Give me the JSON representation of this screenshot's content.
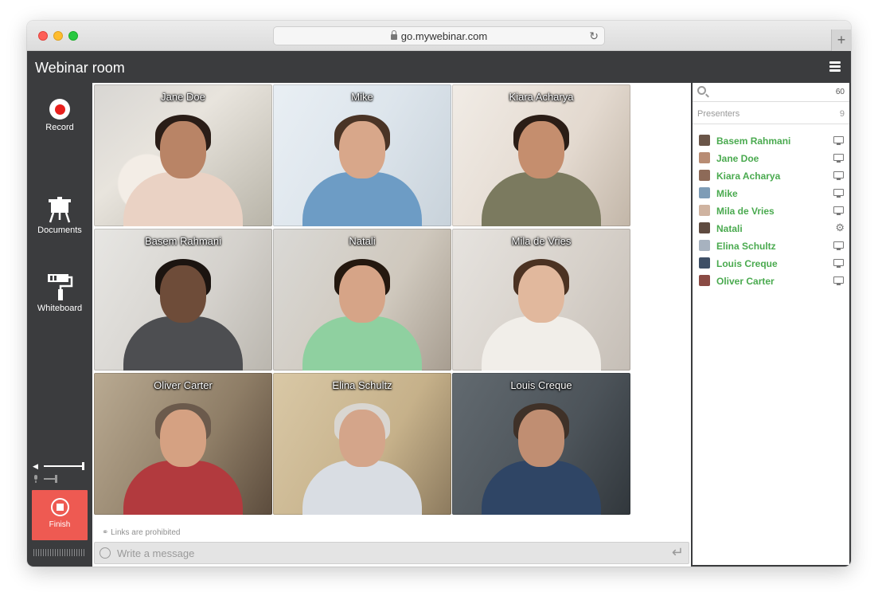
{
  "browser": {
    "url": "go.mywebinar.com"
  },
  "app": {
    "title": "Webinar room"
  },
  "sidebar": {
    "record_label": "Record",
    "documents_label": "Documents",
    "whiteboard_label": "Whiteboard",
    "finish_label": "Finish"
  },
  "videos": [
    {
      "name": "Jane Doe"
    },
    {
      "name": "Mike"
    },
    {
      "name": "Kiara Acharya"
    },
    {
      "name": "Basem Rahmani"
    },
    {
      "name": "Natali"
    },
    {
      "name": "Mila de Vries"
    },
    {
      "name": "Oliver Carter"
    },
    {
      "name": "Elina Schultz"
    },
    {
      "name": "Louis Creque"
    }
  ],
  "chat": {
    "links_note": "Links are prohibited",
    "placeholder": "Write a message"
  },
  "participants": {
    "search_count": "60",
    "section_label": "Presenters",
    "section_count": "9",
    "list": [
      {
        "name": "Basem Rahmani",
        "icon": "monitor-icon"
      },
      {
        "name": "Jane Doe",
        "icon": "monitor-icon"
      },
      {
        "name": "Kiara Acharya",
        "icon": "monitor-icon"
      },
      {
        "name": "Mike",
        "icon": "monitor-icon"
      },
      {
        "name": "Mila de Vries",
        "icon": "monitor-icon"
      },
      {
        "name": "Natali",
        "icon": "gear-icon"
      },
      {
        "name": "Elina Schultz",
        "icon": "monitor-icon"
      },
      {
        "name": "Louis Creque",
        "icon": "monitor-icon"
      },
      {
        "name": "Oliver Carter",
        "icon": "monitor-icon"
      }
    ]
  },
  "colors": {
    "presenter_name": "#4aaa4f",
    "finish_button": "#ee5a52",
    "record_dot": "#e8201d",
    "dark_chrome": "#3b3c3e"
  }
}
